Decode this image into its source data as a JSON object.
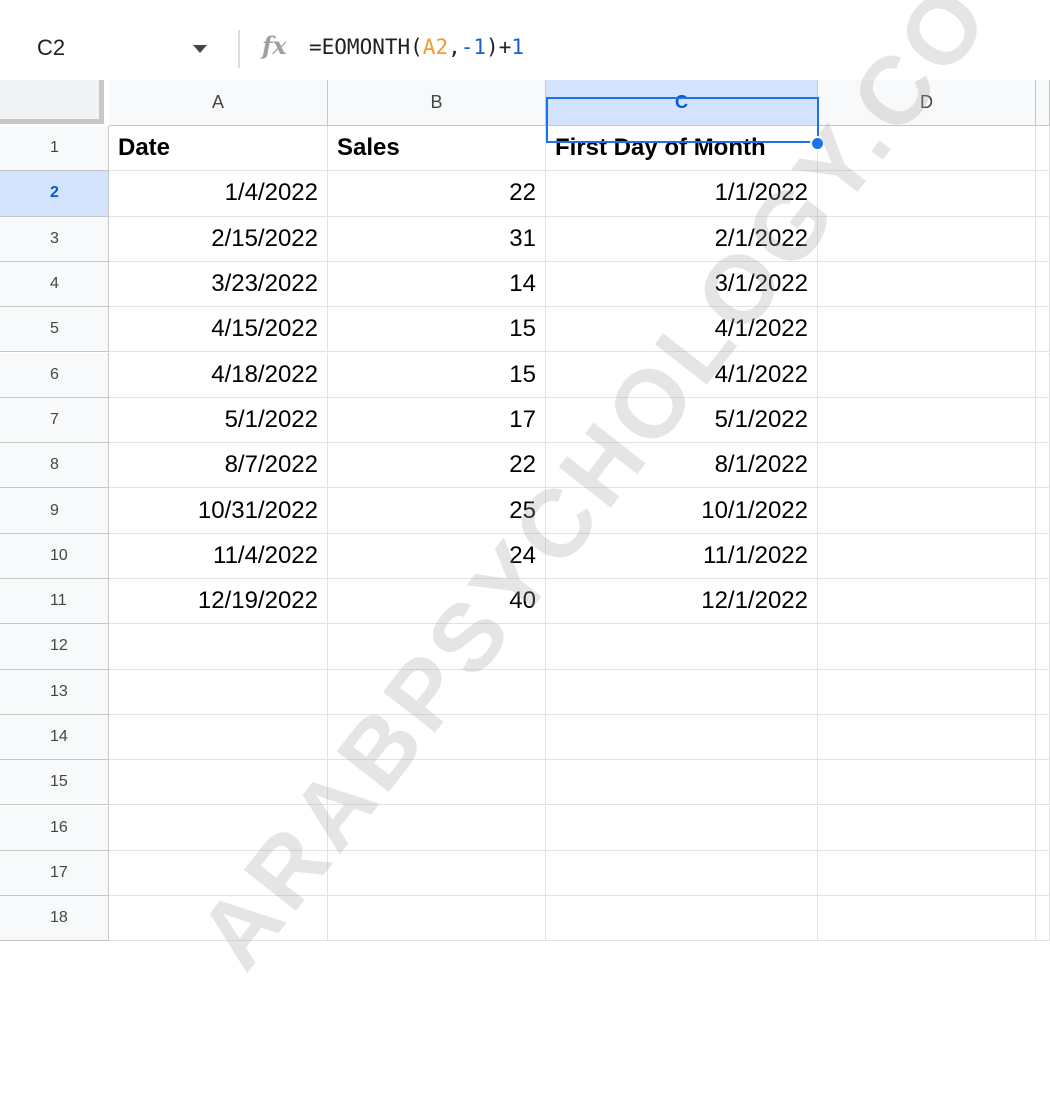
{
  "formula_bar": {
    "name_box": "C2",
    "fx_symbol": "fx",
    "formula_parts": [
      "=EOMONTH(",
      "A2",
      ",",
      "-1",
      ")+",
      "1"
    ]
  },
  "columns": [
    "A",
    "B",
    "C",
    "D"
  ],
  "selected_column": "C",
  "selected_row": "2",
  "rows": [
    {
      "num": "1",
      "a": "Date",
      "b": "Sales",
      "c": "First Day of Month"
    },
    {
      "num": "2",
      "a": "1/4/2022",
      "b": "22",
      "c": "1/1/2022"
    },
    {
      "num": "3",
      "a": "2/15/2022",
      "b": "31",
      "c": "2/1/2022"
    },
    {
      "num": "4",
      "a": "3/23/2022",
      "b": "14",
      "c": "3/1/2022"
    },
    {
      "num": "5",
      "a": "4/15/2022",
      "b": "15",
      "c": "4/1/2022"
    },
    {
      "num": "6",
      "a": "4/18/2022",
      "b": "15",
      "c": "4/1/2022"
    },
    {
      "num": "7",
      "a": "5/1/2022",
      "b": "17",
      "c": "5/1/2022"
    },
    {
      "num": "8",
      "a": "8/7/2022",
      "b": "22",
      "c": "8/1/2022"
    },
    {
      "num": "9",
      "a": "10/31/2022",
      "b": "25",
      "c": "10/1/2022"
    },
    {
      "num": "10",
      "a": "11/4/2022",
      "b": "24",
      "c": "11/1/2022"
    },
    {
      "num": "11",
      "a": "12/19/2022",
      "b": "40",
      "c": "12/1/2022"
    },
    {
      "num": "12",
      "a": "",
      "b": "",
      "c": ""
    },
    {
      "num": "13",
      "a": "",
      "b": "",
      "c": ""
    },
    {
      "num": "14",
      "a": "",
      "b": "",
      "c": ""
    },
    {
      "num": "15",
      "a": "",
      "b": "",
      "c": ""
    },
    {
      "num": "16",
      "a": "",
      "b": "",
      "c": ""
    },
    {
      "num": "17",
      "a": "",
      "b": "",
      "c": ""
    },
    {
      "num": "18",
      "a": "",
      "b": "",
      "c": ""
    }
  ],
  "watermark": "ARABPSYCHOLOGY.CO",
  "colors": {
    "selection": "#1a73e8",
    "header_selected": "#d3e3fd",
    "ref": "#f29a2e",
    "number": "#1a5fd8"
  }
}
